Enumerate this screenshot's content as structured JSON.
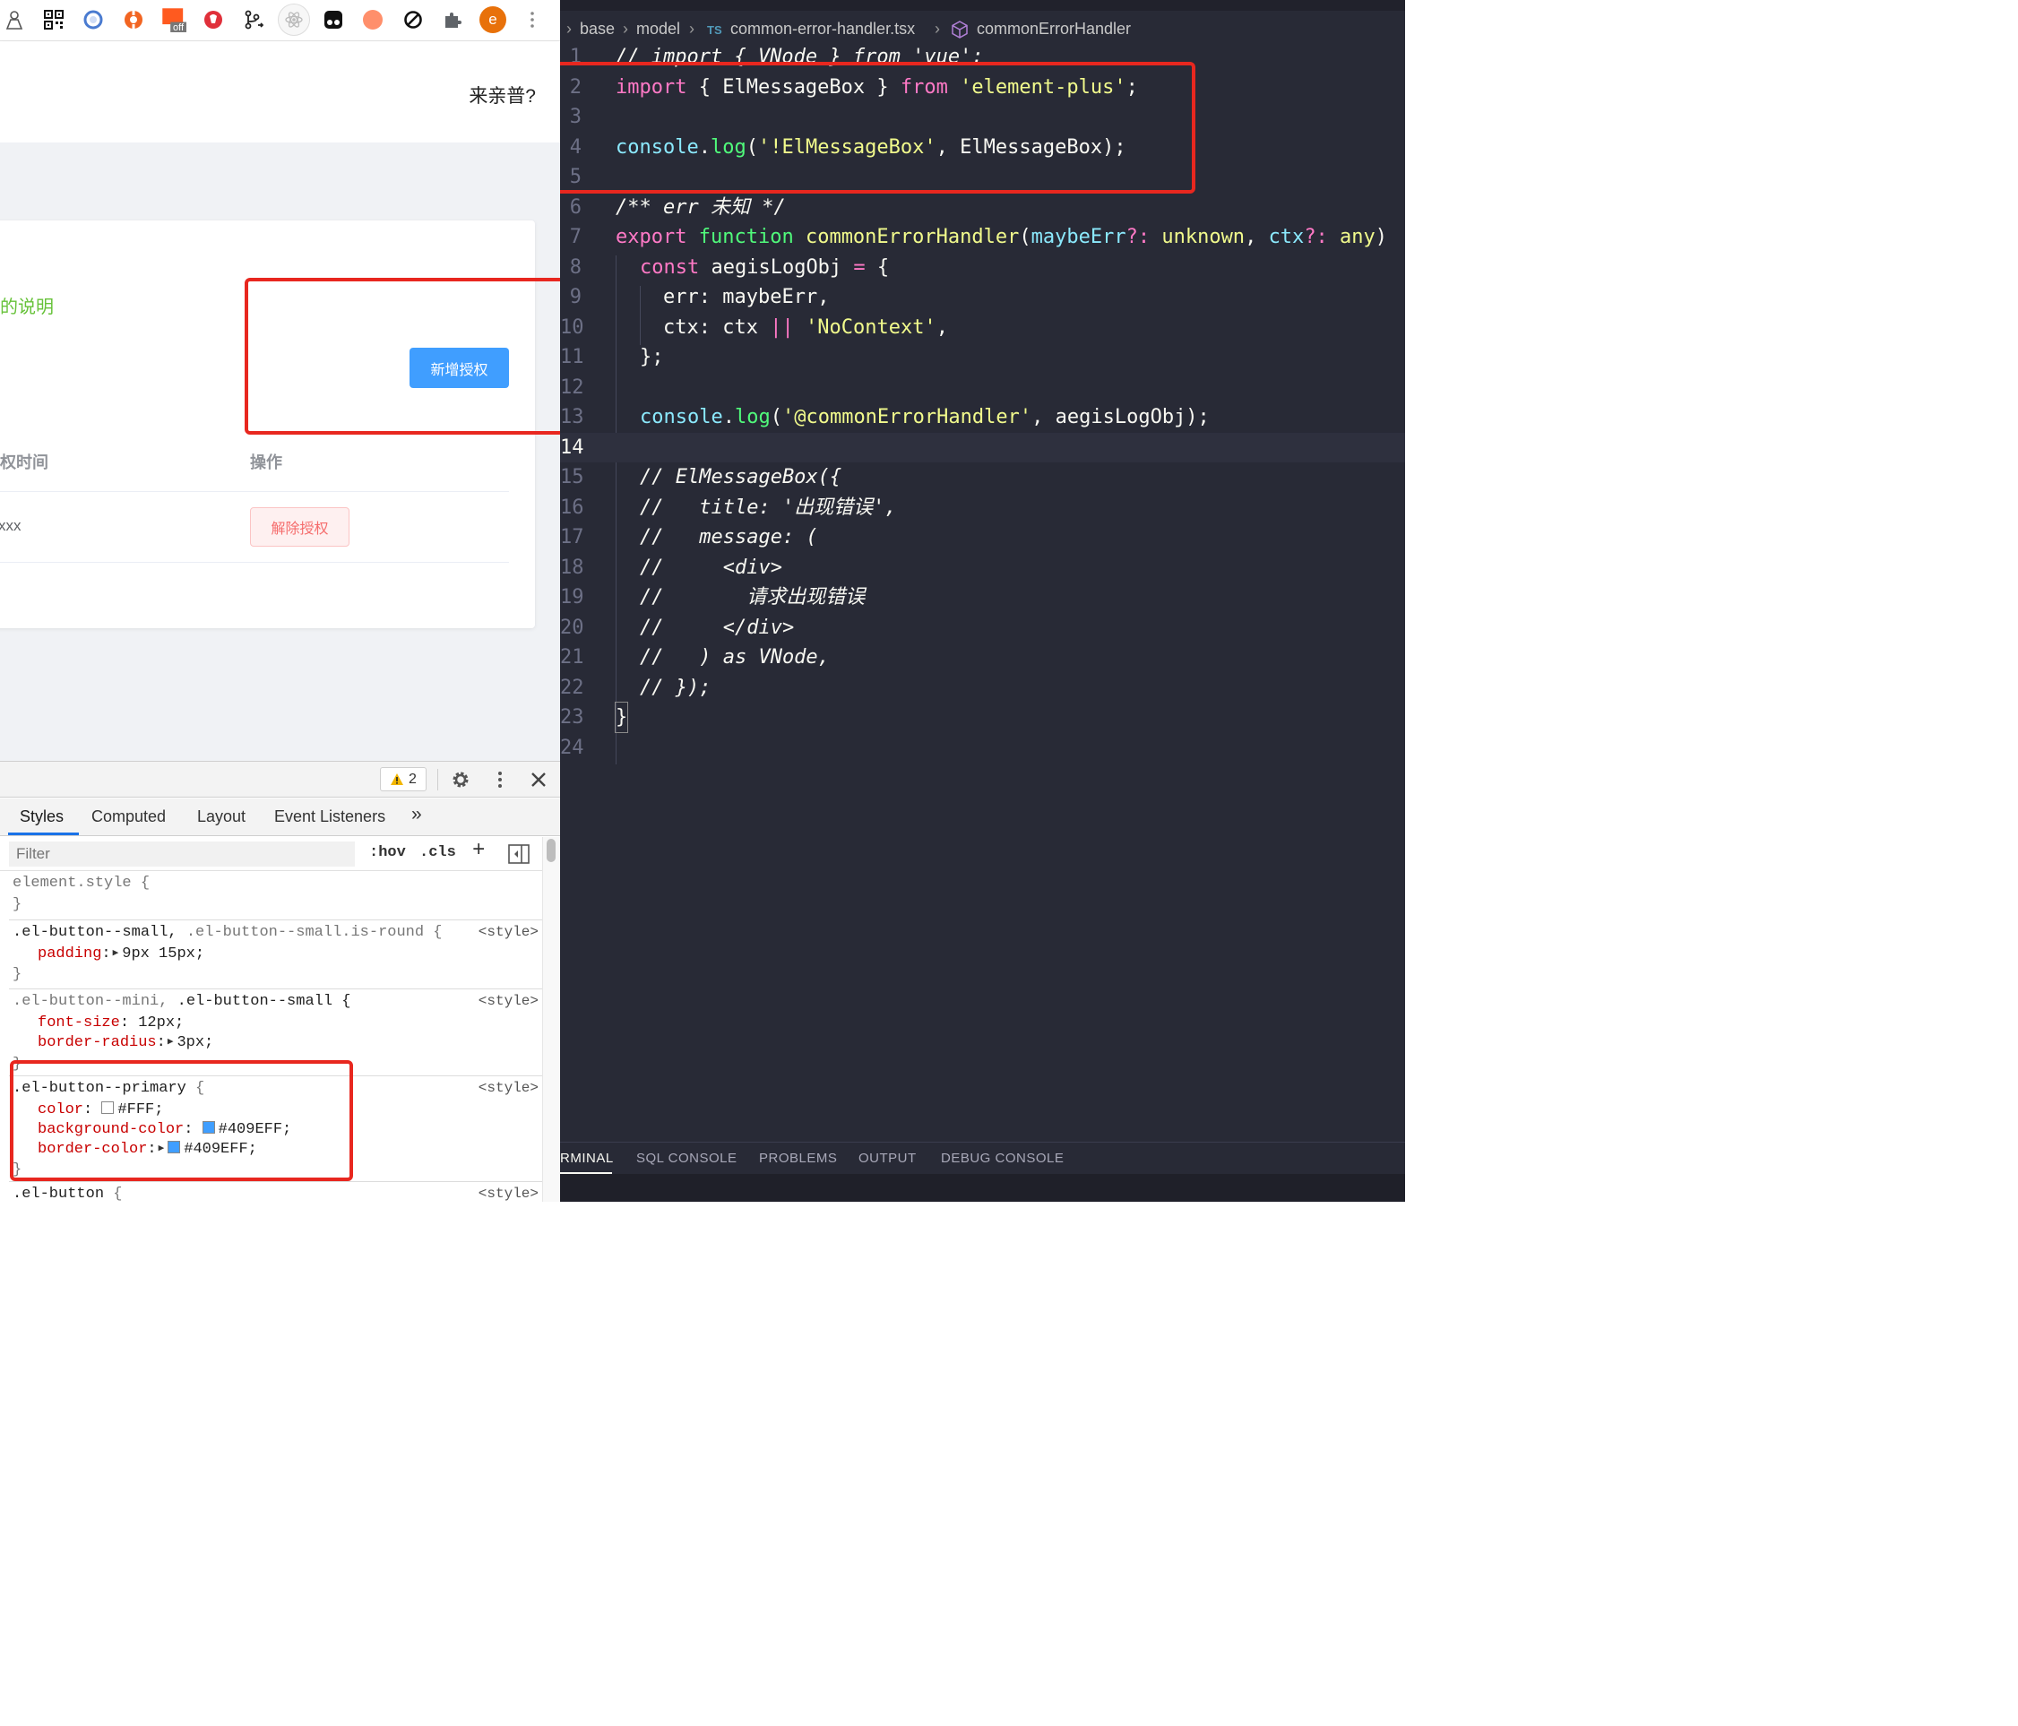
{
  "browser": {
    "extensions": [
      {
        "name": "ext-user-icon",
        "color": "#555555"
      },
      {
        "name": "qr-code-icon",
        "color": "#111111"
      },
      {
        "name": "ring-icon",
        "color": "#4a7bd0"
      },
      {
        "name": "lifebuoy-icon",
        "color": "#f26522"
      },
      {
        "name": "css-off-icon",
        "color": "#ff5a1f",
        "badge": "off"
      },
      {
        "name": "record-icon",
        "color": "#e0303a"
      },
      {
        "name": "git-branch-icon",
        "color": "#222222"
      },
      {
        "name": "react-devtools-icon",
        "color": "#bbbbbb"
      },
      {
        "name": "tampermonkey-icon",
        "color": "#111111"
      },
      {
        "name": "orange-circle-icon",
        "color": "#ff8f6b"
      },
      {
        "name": "block-icon",
        "color": "#111111"
      },
      {
        "name": "puzzle-icon",
        "color": "#5f6368"
      }
    ],
    "profile_initial": "e",
    "profile_color": "#e8710a",
    "header_text": "来亲普?",
    "card": {
      "note": "的说明",
      "add_button": "新增授权",
      "col_time": "权时间",
      "col_action": "操作",
      "row_time": "xxx",
      "revoke_button": "解除授权"
    }
  },
  "devtools": {
    "warning_count": "2",
    "tabs": [
      "Styles",
      "Computed",
      "Layout",
      "Event Listeners"
    ],
    "more_tabs": "»",
    "filter_placeholder": "Filter",
    "hov": ":hov",
    "cls": ".cls",
    "plus": "+",
    "rules": {
      "r1": {
        "selector": "element.style {",
        "close": "}"
      },
      "r2": {
        "sel_a": ".el-button--small,",
        "sel_b": " .el-button--small.is-round {",
        "source": "<style>",
        "prop": "padding",
        "value": "9px 15px;",
        "close": "}"
      },
      "r3": {
        "sel_a": ".el-button--mini,",
        "sel_b": " .el-button--small {",
        "source": "<style>",
        "p1": "font-size",
        "v1": "12px;",
        "p2": "border-radius",
        "v2": "3px;",
        "close": "}"
      },
      "r4": {
        "selector": ".el-button--primary",
        "brace": " {",
        "source": "<style>",
        "p1": "color",
        "v1": "#FFF;",
        "c1": "#FFFFFF",
        "p2": "background-color",
        "v2": "#409EFF;",
        "c2": "#409EFF",
        "p3": "border-color",
        "v3": "#409EFF;",
        "c3": "#409EFF",
        "close": "}"
      },
      "r5": {
        "selector": ".el-button",
        "brace": " {",
        "source": "<style>"
      }
    }
  },
  "editor": {
    "breadcrumb": {
      "base": "base",
      "model": "model",
      "ts": "TS",
      "file": "common-error-handler.tsx",
      "symbol": "commonErrorHandler"
    },
    "lines": {
      "n": [
        "1",
        "2",
        "3",
        "4",
        "5",
        "6",
        "7",
        "8",
        "9",
        "10",
        "11",
        "12",
        "13",
        "14",
        "15",
        "16",
        "17",
        "18",
        "19",
        "20",
        "21",
        "22",
        "23",
        "24"
      ],
      "l1": "// import { VNode } from 'vue';",
      "l2": {
        "kw": "import",
        "a": " { ElMessageBox } ",
        "from": "from",
        "sp": " ",
        "str": "'element-plus'",
        "end": ";"
      },
      "l4": {
        "a": "console",
        "b": ".",
        "c": "log",
        "d": "(",
        "s": "'!ElMessageBox'",
        "e": ", ElMessageBox);"
      },
      "l6": "/** err 未知 */",
      "l7": {
        "kw": "export",
        "sp": " ",
        "fnkw": "function",
        "sp2": " ",
        "name": "commonErrorHandler",
        "p": "(",
        "a1": "maybeErr",
        "q1": "?:",
        "t1": " unknown",
        "c": ", ",
        "a2": "ctx",
        "q2": "?:",
        "t2": " any",
        "e": ")"
      },
      "l8": {
        "kw": "const",
        "name": " aegisLogObj",
        "eq": " =",
        "b": " {"
      },
      "l9": {
        "k": "err",
        "c": ": maybeErr,"
      },
      "l10": {
        "k": "ctx",
        "c": ": ctx ",
        "op": "||",
        "sp": " ",
        "s": "'NoContext'",
        "e": ","
      },
      "l11": "};",
      "l13": {
        "a": "console",
        "b": ".",
        "c": "log",
        "d": "(",
        "s": "'@commonErrorHandler'",
        "e": ", aegisLogObj);"
      },
      "l15": "// ElMessageBox({",
      "l16": "//   title: '出现错误',",
      "l17": "//   message: (",
      "l18": "//     <div>",
      "l19": "//       请求出现错误",
      "l20": "//     </div>",
      "l21": "//   ) as VNode,",
      "l22": "// });",
      "l23": "}"
    },
    "panel_tabs": [
      "RMINAL",
      "SQL CONSOLE",
      "PROBLEMS",
      "OUTPUT",
      "DEBUG CONSOLE"
    ]
  }
}
